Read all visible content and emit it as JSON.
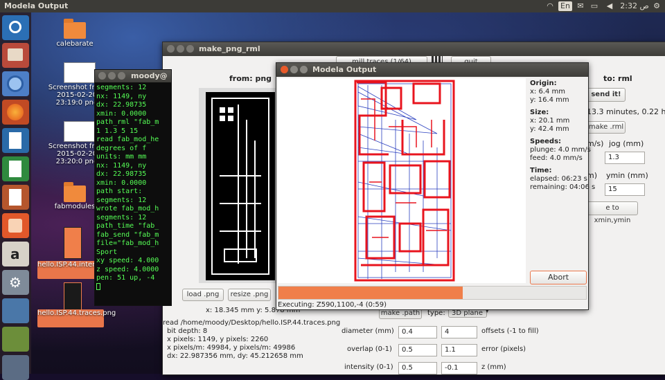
{
  "top_panel": {
    "title": "Modela Output",
    "keyboard": "En",
    "time": "2:32 ص"
  },
  "desktop_icons": [
    {
      "label": "calebarate"
    },
    {
      "label": "Screenshot from 2015-02-20 23:19:0 png"
    },
    {
      "label": "Screenshot from 2015-02-20 23:20:0 png"
    },
    {
      "label": "fabmodules"
    },
    {
      "label": "hello.ISP.44.interior.png"
    },
    {
      "label": "hello.ISP.44.traces.png"
    }
  ],
  "terminal": {
    "title": "moody@",
    "lines": [
      "  segments: 12",
      "  nx: 1149, ny",
      "  dx: 22.98735",
      "  xmin: 0.0000",
      "path_rml \"fab_m",
      "1 1.3 5 15",
      "read fab_mod_he",
      "  degrees of f",
      "  units: mm mm",
      "  nx: 1149, ny",
      "  dx: 22.98735",
      "  xmin: 0.0000",
      "  path start:",
      "  segments: 12",
      "wrote fab_mod_h",
      "  segments: 12",
      "path_time \"fab_",
      "fab_send \"fab_m",
      "file=\"fab_mod_h",
      "Sport",
      "xy speed: 4.000",
      "z speed: 4.0000",
      "pen: 51 up, -4"
    ]
  },
  "make_png": {
    "title": "make_png_rml",
    "dropdown": "mill traces (1/64)",
    "quit": "quit",
    "from_label": "from: png",
    "to_label": "to: rml",
    "send_it": "send it!",
    "time_estimate": "13.3 minutes, 0.22 hours",
    "make_rml": "make .rml",
    "xy_speed_label": "m/s)",
    "jog_label": "jog (mm)",
    "jog_value": "1.3",
    "xmin_label": "m)",
    "ymin_label": "ymin (mm)",
    "ymin_value": "15",
    "move_button": "e to xmin,ymin",
    "load_png": "load .png",
    "resize_png": "resize .png",
    "coords": "x: 18.345 mm  y: 5.878 mm",
    "make_path": "make .path",
    "type_label": "type:",
    "type_value": "3D plane",
    "info_lines": [
      "read /home/moody/Desktop/hello.ISP.44.traces.png",
      "bit depth: 8",
      "x pixels: 1149, y pixels: 2260",
      "x pixels/m: 49984, y pixels/m: 49986",
      "dx: 22.987356 mm, dy: 45.212658 mm"
    ],
    "params": [
      {
        "label": "diameter (mm)",
        "value": "0.4",
        "label2": "offsets (-1 to fill)",
        "value2": "4"
      },
      {
        "label": "overlap (0-1)",
        "value": "0.5",
        "label2": "error (pixels)",
        "value2": "1.1"
      },
      {
        "label": "intensity (0-1)",
        "value": "0.5",
        "label2": "z (mm)",
        "value2": "-0.1"
      }
    ]
  },
  "modela": {
    "title": "Modela Output",
    "origin_label": "Origin:",
    "origin_x": "x: 6.4 mm",
    "origin_y": "y: 16.4 mm",
    "size_label": "Size:",
    "size_x": "x: 20.1 mm",
    "size_y": "y: 42.4 mm",
    "speeds_label": "Speeds:",
    "plunge": "plunge: 4.0 mm/s",
    "feed": "feed: 4.0 mm/s",
    "time_label": "Time:",
    "elapsed": "elapsed: 06:23 s",
    "remaining": "remaining: 04:06 s",
    "abort": "Abort",
    "progress": 0.6,
    "executing": "Executing: Z590,1100,-4 (0:59)"
  },
  "colors": {
    "accent": "#f07f4a",
    "trace_red": "#e8141e",
    "path_blue": "#2a3fbf",
    "terminal_green": "#56ff56"
  }
}
